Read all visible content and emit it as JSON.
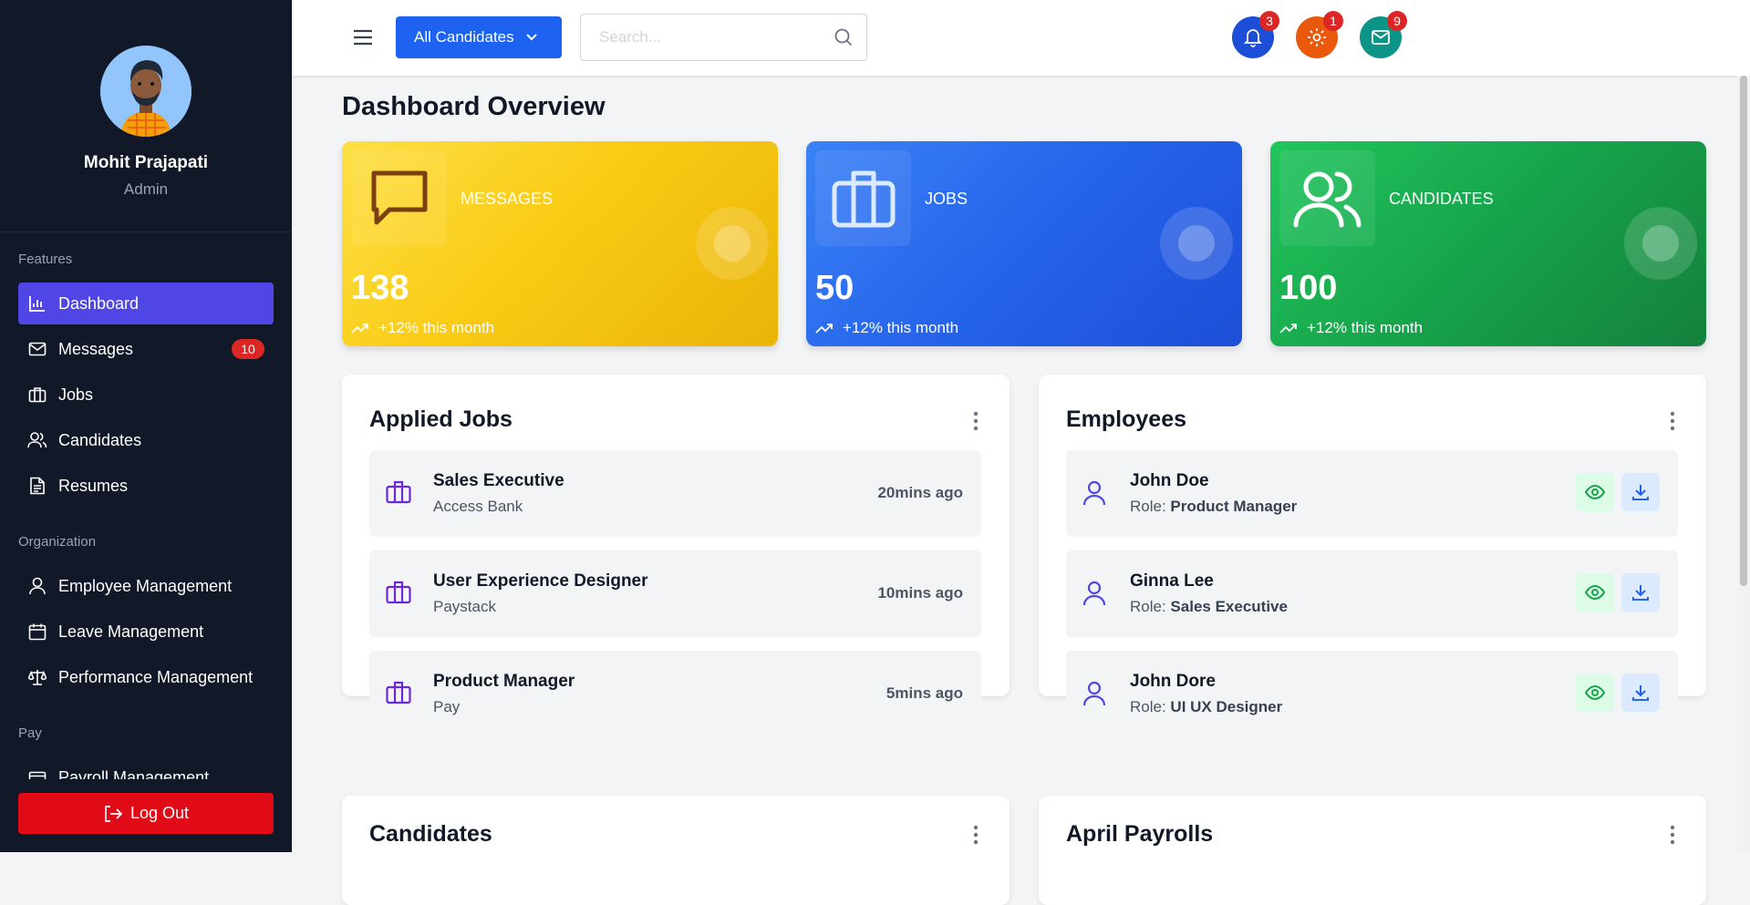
{
  "sidebar": {
    "profile": {
      "name": "Mohit Prajapati",
      "role": "Admin"
    },
    "sections": {
      "features": "Features",
      "organization": "Organization",
      "pay": "Pay"
    },
    "items": [
      {
        "label": "Dashboard",
        "icon": "bar-chart-icon",
        "active": true
      },
      {
        "label": "Messages",
        "icon": "mail-icon",
        "badge": "10"
      },
      {
        "label": "Jobs",
        "icon": "briefcase-icon"
      },
      {
        "label": "Candidates",
        "icon": "users-icon"
      },
      {
        "label": "Resumes",
        "icon": "document-icon"
      },
      {
        "label": "Employee Management",
        "icon": "user-icon"
      },
      {
        "label": "Leave Management",
        "icon": "calendar-icon"
      },
      {
        "label": "Performance Management",
        "icon": "scale-icon"
      },
      {
        "label": "Payroll Management",
        "icon": "payroll-icon"
      }
    ],
    "logout_label": "Log Out"
  },
  "topbar": {
    "filter_label": "All Candidates",
    "search_placeholder": "Search...",
    "notifications": {
      "icon": "bell-icon",
      "count": "3",
      "color": "#1d4ed8"
    },
    "settings": {
      "icon": "gear-icon",
      "count": "1",
      "color": "#ea580c"
    },
    "mail": {
      "icon": "mail-icon",
      "count": "9",
      "color": "#0d9488"
    }
  },
  "main": {
    "title": "Dashboard Overview",
    "stats": [
      {
        "label": "MESSAGES",
        "value": "138",
        "trend": "+12% this month",
        "icon": "chat-icon",
        "color": "#facc15"
      },
      {
        "label": "JOBS",
        "value": "50",
        "trend": "+12% this month",
        "icon": "briefcase-icon",
        "color": "#2563eb"
      },
      {
        "label": "CANDIDATES",
        "value": "100",
        "trend": "+12% this month",
        "icon": "users-icon",
        "color": "#16a34a"
      }
    ],
    "applied_jobs": {
      "title": "Applied Jobs",
      "rows": [
        {
          "title": "Sales Executive",
          "company": "Access Bank",
          "time": "20mins ago"
        },
        {
          "title": "User Experience Designer",
          "company": "Paystack",
          "time": "10mins ago"
        },
        {
          "title": "Product Manager",
          "company": "Pay",
          "time": "5mins ago"
        }
      ]
    },
    "employees": {
      "title": "Employees",
      "role_prefix": "Role: ",
      "rows": [
        {
          "name": "John Doe",
          "role": "Product Manager"
        },
        {
          "name": "Ginna Lee",
          "role": "Sales Executive"
        },
        {
          "name": "John Dore",
          "role": "UI UX Designer"
        }
      ]
    },
    "candidates_title": "Candidates",
    "payrolls_title": "April Payrolls"
  }
}
